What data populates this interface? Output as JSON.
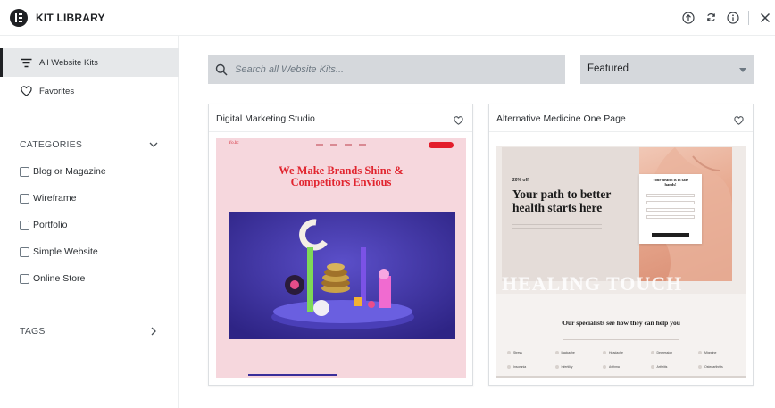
{
  "header": {
    "title": "KIT LIBRARY",
    "icons": [
      "export-icon",
      "sync-icon",
      "info-icon",
      "close-icon"
    ]
  },
  "sidebar": {
    "nav": [
      {
        "label": "All Website Kits",
        "icon": "filter-lines-icon",
        "active": true
      },
      {
        "label": "Favorites",
        "icon": "heart-icon",
        "active": false
      }
    ],
    "categories_label": "CATEGORIES",
    "categories": [
      {
        "label": "Blog or Magazine",
        "checked": false
      },
      {
        "label": "Wireframe",
        "checked": false
      },
      {
        "label": "Portfolio",
        "checked": false
      },
      {
        "label": "Simple Website",
        "checked": false
      },
      {
        "label": "Online Store",
        "checked": false
      }
    ],
    "tags_label": "TAGS"
  },
  "toolbar": {
    "search_placeholder": "Search all Website Kits...",
    "search_value": "",
    "sort_selected": "Featured"
  },
  "kits": [
    {
      "title": "Digital Marketing Studio",
      "favorited": false,
      "preview": {
        "brand": "Yo.hc",
        "headline": "We Make Brands Shine & Competitors Envious"
      }
    },
    {
      "title": "Alternative Medicine One Page",
      "favorited": false,
      "preview": {
        "sale": "20% off",
        "headline": "Your path to better health starts here",
        "form_title": "Your health is in safe hands!",
        "banner": "HEALING TOUCH",
        "specialists": "Our specialists see how they can help you",
        "specialties_row1": [
          "Stress",
          "Backache",
          "Headache",
          "Depression",
          "Migraine"
        ],
        "specialties_row2": [
          "Insomnia",
          "Infertility",
          "Asthma",
          "Arthritis",
          "Osteoarthritis"
        ]
      }
    }
  ],
  "colors": {
    "accent_dark": "#1f2124",
    "sidebar_active_bg": "#e6e8ea",
    "input_bg": "#d5d8dc",
    "kit1_bg": "#f6d7dd",
    "kit1_accent": "#e1252f",
    "kit1_scene": "#3a2f9a"
  }
}
